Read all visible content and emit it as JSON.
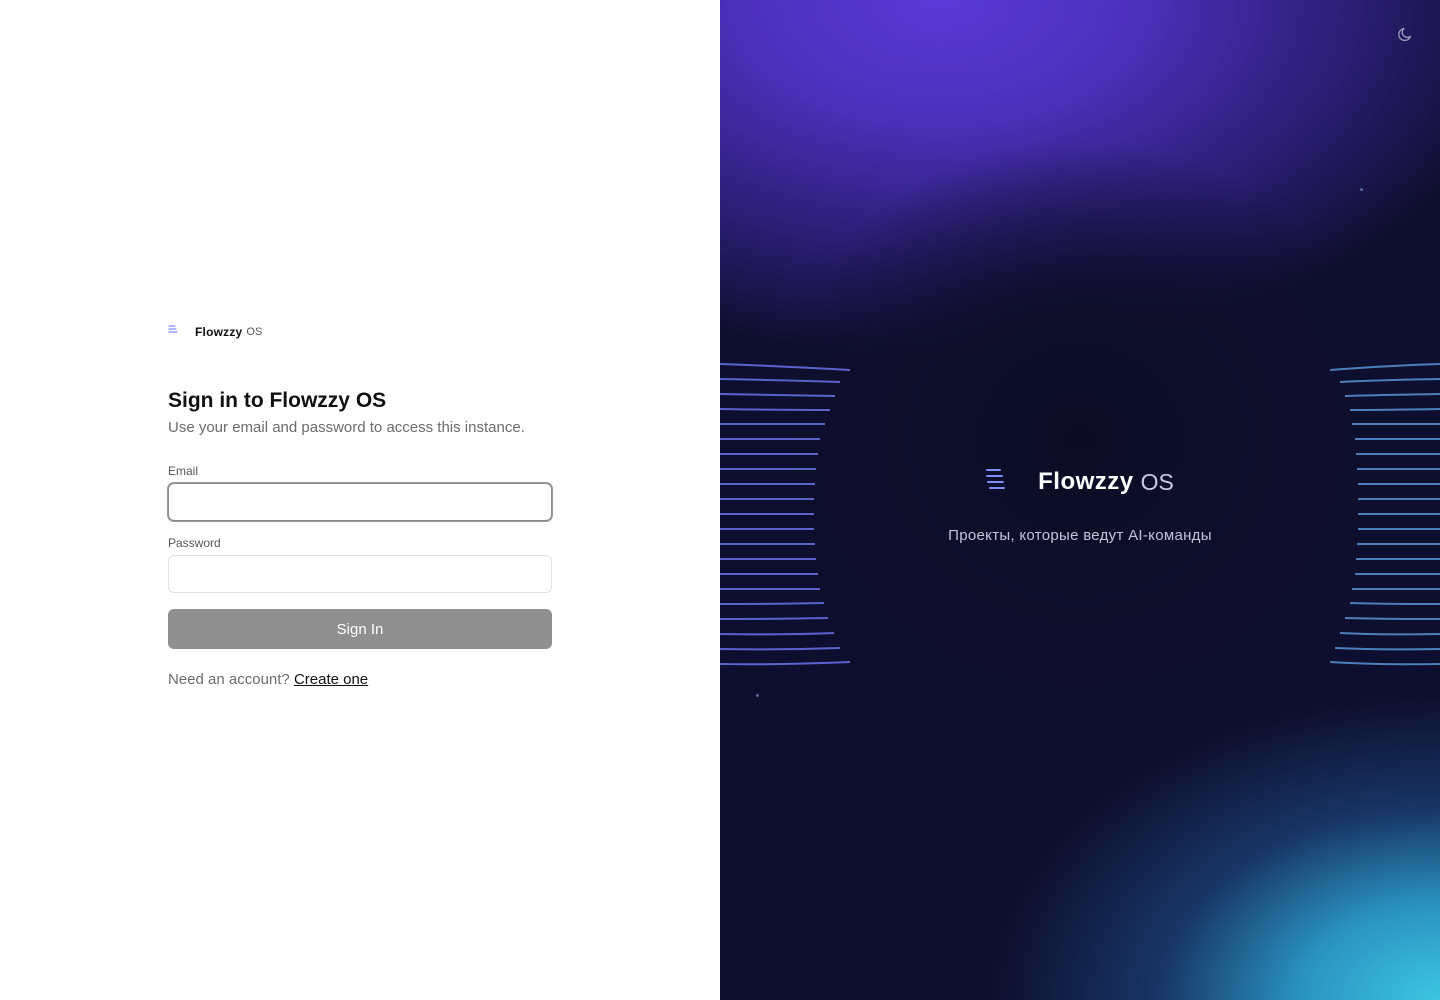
{
  "brand": {
    "name": "Flowzzy",
    "suffix": "OS"
  },
  "auth": {
    "title": "Sign in to Flowzzy OS",
    "subtitle": "Use your email and password to access this instance.",
    "email_label": "Email",
    "email_value": "",
    "password_label": "Password",
    "password_value": "",
    "submit_label": "Sign In",
    "footer_prompt": "Need an account?",
    "footer_link": "Create one"
  },
  "hero": {
    "brand_name": "Flowzzy",
    "brand_suffix": "OS",
    "tagline": "Проекты, которые ведут AI-команды"
  },
  "icons": {
    "logo": "flowzzy-logo-icon",
    "theme_toggle": "moon-icon"
  },
  "colors": {
    "button_bg": "#8f8f8f",
    "hero_purple": "#4a2fb8",
    "hero_cyan": "#3cc6e0",
    "hero_dark": "#0e0f2e"
  }
}
